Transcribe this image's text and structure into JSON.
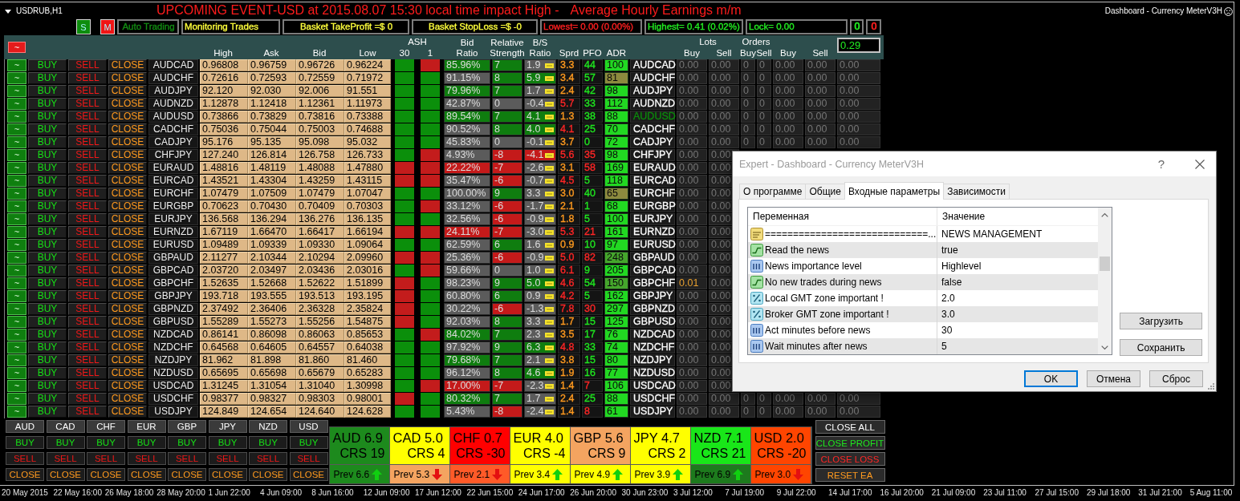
{
  "chart": {
    "symbol": "USDRUB,H1",
    "headline": [
      "UPCOMING EVENT-USD at 2015.08.07 15:30 local time impact High -",
      "Average Hourly Earnings m/m"
    ],
    "indicator": "Dashboard - Currency MeterV3H"
  },
  "controls": {
    "modes": [
      {
        "label": "S",
        "color": "#0d8d0d"
      },
      {
        "label": "M",
        "color": "#f01515"
      }
    ],
    "status": [
      {
        "text": "Auto Trading",
        "color": "#128c12"
      },
      {
        "text": "Monitoring Trades",
        "color": "#ffff3c"
      },
      {
        "text": "Basket TakeProfit =$ 0",
        "color": "#ffff3c"
      },
      {
        "text": "Basket StopLoss =$ -0",
        "color": "#ffff3c"
      },
      {
        "text": "Lowest= 0.00 (0.00%)",
        "color": "#ff2020"
      },
      {
        "text": "Highest= 0.41 (0.02%)",
        "color": "#22ee22"
      },
      {
        "text": "Lock= 0.00",
        "color": "#22ee22"
      }
    ],
    "counters": [
      {
        "text": "0",
        "color": "#22ee22"
      },
      {
        "text": "0",
        "color": "#ff2020"
      }
    ]
  },
  "header": {
    "toggle": "~",
    "high": "High",
    "ask": "Ask",
    "bid": "Bid",
    "low": "Low",
    "ash": {
      "title": "ASH",
      "periods": [
        "30",
        "1"
      ]
    },
    "bid_ratio": "Bid Ratio",
    "strength": "Relative Strength",
    "bs_ratio": "B/S Ratio",
    "spread": "Sprd",
    "pfo": "PFO",
    "adr": "ADR",
    "lots": {
      "title": "Lots",
      "columns": [
        "Buy",
        "Sell"
      ]
    },
    "orders": {
      "title": "Orders",
      "columns": [
        "Buy",
        "Sell"
      ]
    },
    "totals": [
      "Buy",
      "Sell"
    ],
    "field": "0.29"
  },
  "rows": [
    {
      "actions": [
        "~",
        "BUY",
        "SELL",
        "CLOSE"
      ],
      "pair": "AUDCAD",
      "high": "0.96808",
      "ask": "0.96759",
      "bid": "0.96726",
      "low": "0.96224",
      "ash_30": {
        "color": "#0b8f0b"
      },
      "ash_1": {
        "color": "#c31c1c"
      },
      "bid_ratio": {
        "text": "85.96%",
        "color": "#0f7d0f"
      },
      "strength": {
        "text": "7",
        "color": "#0f7d0f"
      },
      "bs_ratio": {
        "text": "1.9",
        "color": "#5b5b5b"
      },
      "spread": {
        "text": "3.3",
        "color": "#ff9a1f"
      },
      "pfo": {
        "text": "44",
        "color": "#1fe61f"
      },
      "adr": {
        "text": "100",
        "color": "#22d822"
      },
      "label": {
        "text": "AUDCAD",
        "color": "#ffffff"
      },
      "open_position": false,
      "positions": [
        "0.00",
        "0.00",
        "0",
        "0",
        "0.00",
        "0.00",
        "0.00"
      ]
    },
    {
      "actions": [
        "~",
        "BUY",
        "SELL",
        "CLOSE"
      ],
      "pair": "AUDCHF",
      "high": "0.72616",
      "ask": "0.72593",
      "bid": "0.72559",
      "low": "0.71972",
      "ash_30": {
        "color": "#0b8f0b"
      },
      "ash_1": {
        "color": "#0b8f0b"
      },
      "bid_ratio": {
        "text": "91.15%",
        "color": "#5b5b5b"
      },
      "strength": {
        "text": "8",
        "color": "#0f7d0f"
      },
      "bs_ratio": {
        "text": "5.9",
        "color": "#0f7d0f"
      },
      "spread": {
        "text": "3.4",
        "color": "#ff9a1f"
      },
      "pfo": {
        "text": "57",
        "color": "#1fe61f"
      },
      "adr": {
        "text": "81",
        "color": "#8c8a3e"
      },
      "label": {
        "text": "AUDCHF",
        "color": "#ffffff"
      },
      "open_position": false,
      "positions": [
        "0.00",
        "0.00",
        "0",
        "0",
        "0.00",
        "0.00",
        "0.00"
      ]
    },
    {
      "actions": [
        "~",
        "BUY",
        "SELL",
        "CLOSE"
      ],
      "pair": "AUDJPY",
      "high": "92.120",
      "ask": "92.030",
      "bid": "92.006",
      "low": "91.551",
      "ash_30": {
        "color": "#0b8f0b"
      },
      "ash_1": {
        "color": "#0b8f0b"
      },
      "bid_ratio": {
        "text": "79.96%",
        "color": "#0f7d0f"
      },
      "strength": {
        "text": "7",
        "color": "#0f7d0f"
      },
      "bs_ratio": {
        "text": "1.7",
        "color": "#5b5b5b"
      },
      "spread": {
        "text": "2.4",
        "color": "#ff9a1f"
      },
      "pfo": {
        "text": "42",
        "color": "#1fe61f"
      },
      "adr": {
        "text": "98",
        "color": "#22d822"
      },
      "label": {
        "text": "AUDJPY",
        "color": "#ffffff"
      },
      "open_position": false,
      "positions": [
        "0.00",
        "0.00",
        "0",
        "0",
        "0.00",
        "0.00",
        "0.00"
      ]
    },
    {
      "actions": [
        "~",
        "BUY",
        "SELL",
        "CLOSE"
      ],
      "pair": "AUDNZD",
      "high": "1.12878",
      "ask": "1.12418",
      "bid": "1.12361",
      "low": "1.11973",
      "ash_30": {
        "color": "#0b8f0b"
      },
      "ash_1": {
        "color": "#0b8f0b"
      },
      "bid_ratio": {
        "text": "42.87%",
        "color": "#5b5b5b"
      },
      "strength": {
        "text": "0",
        "color": "#5b5b5b"
      },
      "bs_ratio": {
        "text": "-0.4",
        "color": "#5b5b5b"
      },
      "spread": {
        "text": "5.7",
        "color": "#ff2626"
      },
      "pfo": {
        "text": "33",
        "color": "#1fe61f"
      },
      "adr": {
        "text": "112",
        "color": "#22d822"
      },
      "label": {
        "text": "AUDNZD",
        "color": "#ffffff"
      },
      "open_position": false,
      "positions": [
        "0.00",
        "0.00",
        "0",
        "0",
        "0.00",
        "0.00",
        "0.00"
      ]
    },
    {
      "actions": [
        "~",
        "BUY",
        "SELL",
        "CLOSE"
      ],
      "pair": "AUDUSD",
      "high": "0.73866",
      "ask": "0.73829",
      "bid": "0.73816",
      "low": "0.73388",
      "ash_30": {
        "color": "#0b8f0b"
      },
      "ash_1": {
        "color": "#0b8f0b"
      },
      "bid_ratio": {
        "text": "89.54%",
        "color": "#0f7d0f"
      },
      "strength": {
        "text": "7",
        "color": "#0f7d0f"
      },
      "bs_ratio": {
        "text": "4.1",
        "color": "#0f7d0f"
      },
      "spread": {
        "text": "1.3",
        "color": "#ff9a1f"
      },
      "pfo": {
        "text": "38",
        "color": "#1fe61f"
      },
      "adr": {
        "text": "88",
        "color": "#22d822"
      },
      "label": {
        "text": "AUDUSD",
        "color": "#0c8c0c"
      },
      "open_position": false,
      "positions": [
        "0.00",
        "0.00",
        "0",
        "0",
        "0.00",
        "0.00",
        "0.00"
      ]
    },
    {
      "actions": [
        "~",
        "BUY",
        "SELL",
        "CLOSE"
      ],
      "pair": "CADCHF",
      "high": "0.75036",
      "ask": "0.75044",
      "bid": "0.75003",
      "low": "0.74688",
      "ash_30": {
        "color": "#0b8f0b"
      },
      "ash_1": {
        "color": "#0b8f0b"
      },
      "bid_ratio": {
        "text": "90.52%",
        "color": "#5b5b5b"
      },
      "strength": {
        "text": "8",
        "color": "#0f7d0f"
      },
      "bs_ratio": {
        "text": "4.0",
        "color": "#0f7d0f"
      },
      "spread": {
        "text": "4.1",
        "color": "#ff2626"
      },
      "pfo": {
        "text": "25",
        "color": "#1fe61f"
      },
      "adr": {
        "text": "70",
        "color": "#22d822"
      },
      "label": {
        "text": "CADCHF",
        "color": "#ffffff"
      },
      "open_position": false,
      "positions": [
        "0.00",
        "0.00",
        "0",
        "0",
        "0.00",
        "0.00",
        "0.00"
      ]
    },
    {
      "actions": [
        "~",
        "BUY",
        "SELL",
        "CLOSE"
      ],
      "pair": "CADJPY",
      "high": "95.176",
      "ask": "95.135",
      "bid": "95.098",
      "low": "95.032",
      "ash_30": {
        "color": "#0b8f0b"
      },
      "ash_1": {
        "color": "#0b8f0b"
      },
      "bid_ratio": {
        "text": "45.83%",
        "color": "#5b5b5b"
      },
      "strength": {
        "text": "0",
        "color": "#5b5b5b"
      },
      "bs_ratio": {
        "text": "-0.1",
        "color": "#5b5b5b"
      },
      "spread": {
        "text": "3.7",
        "color": "#ff9a1f"
      },
      "pfo": {
        "text": "0",
        "color": "#1fe61f"
      },
      "adr": {
        "text": "72",
        "color": "#22d822"
      },
      "label": {
        "text": "CADJPY",
        "color": "#ffffff"
      },
      "open_position": false,
      "positions": [
        "0.00",
        "0.00",
        "0",
        "0",
        "0.00",
        "0.00",
        "0.00"
      ]
    },
    {
      "actions": [
        "~",
        "BUY",
        "SELL",
        "CLOSE"
      ],
      "pair": "CHFJPY",
      "high": "127.240",
      "ask": "126.814",
      "bid": "126.758",
      "low": "126.733",
      "ash_30": {
        "color": "#0b8f0b"
      },
      "ash_1": {
        "color": "#c31c1c"
      },
      "bid_ratio": {
        "text": "4.93%",
        "color": "#5b5b5b"
      },
      "strength": {
        "text": "-8",
        "color": "#c41a1a"
      },
      "bs_ratio": {
        "text": "-4.1",
        "color": "#c41a1a"
      },
      "spread": {
        "text": "5.6",
        "color": "#ff2626"
      },
      "pfo": {
        "text": "35",
        "color": "#ff2626"
      },
      "adr": {
        "text": "98",
        "color": "#22d822"
      },
      "label": {
        "text": "CHFJPY",
        "color": "#ffffff"
      },
      "open_position": false,
      "positions": [
        "0.00",
        "0.00"
      ]
    },
    {
      "actions": [
        "~",
        "BUY",
        "SELL",
        "CLOSE"
      ],
      "pair": "EURAUD",
      "high": "1.48816",
      "ask": "1.48119",
      "bid": "1.48088",
      "low": "1.47880",
      "ash_30": {
        "color": "#c31c1c"
      },
      "ash_1": {
        "color": "#c31c1c"
      },
      "bid_ratio": {
        "text": "22.22%",
        "color": "#c41a1a"
      },
      "strength": {
        "text": "-7",
        "color": "#c41a1a"
      },
      "bs_ratio": {
        "text": "-2.6",
        "color": "#5b5b5b"
      },
      "spread": {
        "text": "3.1",
        "color": "#ff9a1f"
      },
      "pfo": {
        "text": "58",
        "color": "#ff2626"
      },
      "adr": {
        "text": "169",
        "color": "#22d822"
      },
      "label": {
        "text": "EURAUD",
        "color": "#ffffff"
      },
      "open_position": false,
      "positions": [
        "0.00",
        "0.00"
      ]
    },
    {
      "actions": [
        "~",
        "BUY",
        "SELL",
        "CLOSE"
      ],
      "pair": "EURCAD",
      "high": "1.43521",
      "ask": "1.43304",
      "bid": "1.43259",
      "low": "1.43115",
      "ash_30": {
        "color": "#c31c1c"
      },
      "ash_1": {
        "color": "#c31c1c"
      },
      "bid_ratio": {
        "text": "35.47%",
        "color": "#5b5b5b"
      },
      "strength": {
        "text": "-6",
        "color": "#c41a1a"
      },
      "bs_ratio": {
        "text": "-0.7",
        "color": "#5b5b5b"
      },
      "spread": {
        "text": "4.5",
        "color": "#ff2626"
      },
      "pfo": {
        "text": "5",
        "color": "#1fe61f"
      },
      "adr": {
        "text": "118",
        "color": "#22d822"
      },
      "label": {
        "text": "EURCAD",
        "color": "#ffffff"
      },
      "open_position": false,
      "positions": [
        "0.00",
        "0.00"
      ]
    },
    {
      "actions": [
        "~",
        "BUY",
        "SELL",
        "CLOSE"
      ],
      "pair": "EURCHF",
      "high": "1.07479",
      "ask": "1.07509",
      "bid": "1.07479",
      "low": "1.07047",
      "ash_30": {
        "color": "#0b8f0b"
      },
      "ash_1": {
        "color": "#0b8f0b"
      },
      "bid_ratio": {
        "text": "100.00%",
        "color": "#5b5b5b"
      },
      "strength": {
        "text": "9",
        "color": "#0f7d0f"
      },
      "bs_ratio": {
        "text": "3.3",
        "color": "#5b5b5b"
      },
      "spread": {
        "text": "3.0",
        "color": "#ff9a1f"
      },
      "pfo": {
        "text": "40",
        "color": "#1fe61f"
      },
      "adr": {
        "text": "65",
        "color": "#8c8a3e"
      },
      "label": {
        "text": "EURCHF",
        "color": "#ffffff"
      },
      "open_position": false,
      "positions": [
        "0.00",
        "0.00"
      ]
    },
    {
      "actions": [
        "~",
        "BUY",
        "SELL",
        "CLOSE"
      ],
      "pair": "EURGBP",
      "high": "0.70623",
      "ask": "0.70430",
      "bid": "0.70409",
      "low": "0.70303",
      "ash_30": {
        "color": "#0b8f0b"
      },
      "ash_1": {
        "color": "#c31c1c"
      },
      "bid_ratio": {
        "text": "33.12%",
        "color": "#5b5b5b"
      },
      "strength": {
        "text": "-6",
        "color": "#c41a1a"
      },
      "bs_ratio": {
        "text": "-1.7",
        "color": "#5b5b5b"
      },
      "spread": {
        "text": "2.1",
        "color": "#ff9a1f"
      },
      "pfo": {
        "text": "1",
        "color": "#1fe61f"
      },
      "adr": {
        "text": "68",
        "color": "#22d822"
      },
      "label": {
        "text": "EURGBP",
        "color": "#ffffff"
      },
      "open_position": false,
      "positions": [
        "0.00",
        "0.00"
      ]
    },
    {
      "actions": [
        "~",
        "BUY",
        "SELL",
        "CLOSE"
      ],
      "pair": "EURJPY",
      "high": "136.568",
      "ask": "136.294",
      "bid": "136.276",
      "low": "136.135",
      "ash_30": {
        "color": "#0b8f0b"
      },
      "ash_1": {
        "color": "#0b8f0b"
      },
      "bid_ratio": {
        "text": "32.56%",
        "color": "#5b5b5b"
      },
      "strength": {
        "text": "-6",
        "color": "#c41a1a"
      },
      "bs_ratio": {
        "text": "-0.9",
        "color": "#5b5b5b"
      },
      "spread": {
        "text": "1.8",
        "color": "#ff9a1f"
      },
      "pfo": {
        "text": "5",
        "color": "#1fe61f"
      },
      "adr": {
        "text": "100",
        "color": "#22d822"
      },
      "label": {
        "text": "EURJPY",
        "color": "#ffffff"
      },
      "open_position": false,
      "positions": [
        "0.00",
        "0.00"
      ]
    },
    {
      "actions": [
        "~",
        "BUY",
        "SELL",
        "CLOSE"
      ],
      "pair": "EURNZD",
      "high": "1.67119",
      "ask": "1.66470",
      "bid": "1.66417",
      "low": "1.66194",
      "ash_30": {
        "color": "#c31c1c"
      },
      "ash_1": {
        "color": "#c31c1c"
      },
      "bid_ratio": {
        "text": "24.11%",
        "color": "#c41a1a"
      },
      "strength": {
        "text": "-7",
        "color": "#c41a1a"
      },
      "bs_ratio": {
        "text": "-3.0",
        "color": "#5b5b5b"
      },
      "spread": {
        "text": "5.3",
        "color": "#ff2626"
      },
      "pfo": {
        "text": "21",
        "color": "#ff2626"
      },
      "adr": {
        "text": "161",
        "color": "#22d822"
      },
      "label": {
        "text": "EURNZD",
        "color": "#ffffff"
      },
      "open_position": false,
      "positions": [
        "0.00",
        "0.00"
      ]
    },
    {
      "actions": [
        "~",
        "BUY",
        "SELL",
        "CLOSE"
      ],
      "pair": "EURUSD",
      "high": "1.09489",
      "ask": "1.09339",
      "bid": "1.09330",
      "low": "1.09064",
      "ash_30": {
        "color": "#0b8f0b"
      },
      "ash_1": {
        "color": "#0b8f0b"
      },
      "bid_ratio": {
        "text": "62.59%",
        "color": "#5b5b5b"
      },
      "strength": {
        "text": "6",
        "color": "#0f7d0f"
      },
      "bs_ratio": {
        "text": "1.6",
        "color": "#5b5b5b"
      },
      "spread": {
        "text": "0.9",
        "color": "#ff9a1f"
      },
      "pfo": {
        "text": "10",
        "color": "#1fe61f"
      },
      "adr": {
        "text": "97",
        "color": "#22d822"
      },
      "label": {
        "text": "EURUSD",
        "color": "#ffffff"
      },
      "open_position": false,
      "positions": [
        "0.00",
        "0.00"
      ]
    },
    {
      "actions": [
        "~",
        "BUY",
        "SELL",
        "CLOSE"
      ],
      "pair": "GBPAUD",
      "high": "2.11277",
      "ask": "2.10344",
      "bid": "2.10294",
      "low": "2.09960",
      "ash_30": {
        "color": "#c31c1c"
      },
      "ash_1": {
        "color": "#c31c1c"
      },
      "bid_ratio": {
        "text": "25.36%",
        "color": "#5b5b5b"
      },
      "strength": {
        "text": "-6",
        "color": "#c41a1a"
      },
      "bs_ratio": {
        "text": "-0.9",
        "color": "#5b5b5b"
      },
      "spread": {
        "text": "5.0",
        "color": "#ff2626"
      },
      "pfo": {
        "text": "82",
        "color": "#ff2626"
      },
      "adr": {
        "text": "248",
        "color": "#45a62c"
      },
      "label": {
        "text": "GBPAUD",
        "color": "#ffffff"
      },
      "open_position": false,
      "positions": [
        "0.00",
        "0.00"
      ]
    },
    {
      "actions": [
        "~",
        "BUY",
        "SELL",
        "CLOSE"
      ],
      "pair": "GBPCAD",
      "high": "2.03720",
      "ask": "2.03497",
      "bid": "2.03436",
      "low": "2.03016",
      "ash_30": {
        "color": "#0b8f0b"
      },
      "ash_1": {
        "color": "#c31c1c"
      },
      "bid_ratio": {
        "text": "59.66%",
        "color": "#5b5b5b"
      },
      "strength": {
        "text": "0",
        "color": "#5b5b5b"
      },
      "bs_ratio": {
        "text": "1.0",
        "color": "#5b5b5b"
      },
      "spread": {
        "text": "6.1",
        "color": "#ff2626"
      },
      "pfo": {
        "text": "9",
        "color": "#1fe61f"
      },
      "adr": {
        "text": "205",
        "color": "#22d822"
      },
      "label": {
        "text": "GBPCAD",
        "color": "#ffffff"
      },
      "open_position": false,
      "positions": [
        "0.00",
        "0.00"
      ]
    },
    {
      "actions": [
        "~",
        "BUY",
        "SELL",
        "CLOSE"
      ],
      "pair": "GBPCHF",
      "high": "1.52635",
      "ask": "1.52668",
      "bid": "1.52622",
      "low": "1.51899",
      "ash_30": {
        "color": "#c31c1c"
      },
      "ash_1": {
        "color": "#0b8f0b"
      },
      "bid_ratio": {
        "text": "98.23%",
        "color": "#5b5b5b"
      },
      "strength": {
        "text": "9",
        "color": "#0f7d0f"
      },
      "bs_ratio": {
        "text": "5.0",
        "color": "#0f7d0f"
      },
      "spread": {
        "text": "4.6",
        "color": "#ff2626"
      },
      "pfo": {
        "text": "54",
        "color": "#1fe61f"
      },
      "adr": {
        "text": "150",
        "color": "#45a62c"
      },
      "label": {
        "text": "GBPCHF",
        "color": "#ffffff"
      },
      "open_position": true,
      "positions": [
        "0.01",
        "0.00"
      ]
    },
    {
      "actions": [
        "~",
        "BUY",
        "SELL",
        "CLOSE"
      ],
      "pair": "GBPJPY",
      "high": "193.718",
      "ask": "193.555",
      "bid": "193.513",
      "low": "193.195",
      "ash_30": {
        "color": "#c31c1c"
      },
      "ash_1": {
        "color": "#0b8f0b"
      },
      "bid_ratio": {
        "text": "60.80%",
        "color": "#5b5b5b"
      },
      "strength": {
        "text": "6",
        "color": "#0f7d0f"
      },
      "bs_ratio": {
        "text": "0.9",
        "color": "#5b5b5b"
      },
      "spread": {
        "text": "4.2",
        "color": "#ff2626"
      },
      "pfo": {
        "text": "5",
        "color": "#1fe61f"
      },
      "adr": {
        "text": "162",
        "color": "#22d822"
      },
      "label": {
        "text": "GBPJPY",
        "color": "#ffffff"
      },
      "open_position": false,
      "positions": [
        "0.00",
        "0.00"
      ]
    },
    {
      "actions": [
        "~",
        "BUY",
        "SELL",
        "CLOSE"
      ],
      "pair": "GBPNZD",
      "high": "2.37492",
      "ask": "2.36406",
      "bid": "2.36328",
      "low": "2.35824",
      "ash_30": {
        "color": "#c31c1c"
      },
      "ash_1": {
        "color": "#0b8f0b"
      },
      "bid_ratio": {
        "text": "30.22%",
        "color": "#5b5b5b"
      },
      "strength": {
        "text": "-6",
        "color": "#c41a1a"
      },
      "bs_ratio": {
        "text": "-1.3",
        "color": "#5b5b5b"
      },
      "spread": {
        "text": "7.8",
        "color": "#ff2626"
      },
      "pfo": {
        "text": "30",
        "color": "#ff2626"
      },
      "adr": {
        "text": "297",
        "color": "#22d822"
      },
      "label": {
        "text": "GBPNZD",
        "color": "#ffffff"
      },
      "open_position": false,
      "positions": [
        "0.00",
        "0.00"
      ]
    },
    {
      "actions": [
        "~",
        "BUY",
        "SELL",
        "CLOSE"
      ],
      "pair": "GBPUSD",
      "high": "1.55289",
      "ask": "1.55273",
      "bid": "1.55256",
      "low": "1.54875",
      "ash_30": {
        "color": "#c31c1c"
      },
      "ash_1": {
        "color": "#0b8f0b"
      },
      "bid_ratio": {
        "text": "92.03%",
        "color": "#5b5b5b"
      },
      "strength": {
        "text": "8",
        "color": "#0f7d0f"
      },
      "bs_ratio": {
        "text": "3.3",
        "color": "#5b5b5b"
      },
      "spread": {
        "text": "1.7",
        "color": "#ff9a1f"
      },
      "pfo": {
        "text": "15",
        "color": "#1fe61f"
      },
      "adr": {
        "text": "125",
        "color": "#22d822"
      },
      "label": {
        "text": "GBPUSD",
        "color": "#ffffff"
      },
      "open_position": false,
      "positions": [
        "0.00",
        "0.00"
      ]
    },
    {
      "actions": [
        "~",
        "BUY",
        "SELL",
        "CLOSE"
      ],
      "pair": "NZDCAD",
      "high": "0.86141",
      "ask": "0.86098",
      "bid": "0.86063",
      "low": "0.85653",
      "ash_30": {
        "color": "#0b8f0b"
      },
      "ash_1": {
        "color": "#c31c1c"
      },
      "bid_ratio": {
        "text": "84.02%",
        "color": "#0f7d0f"
      },
      "strength": {
        "text": "7",
        "color": "#0f7d0f"
      },
      "bs_ratio": {
        "text": "2.3",
        "color": "#5b5b5b"
      },
      "spread": {
        "text": "3.5",
        "color": "#ff9a1f"
      },
      "pfo": {
        "text": "17",
        "color": "#1fe61f"
      },
      "adr": {
        "text": "76",
        "color": "#22d822"
      },
      "label": {
        "text": "NZDCAD",
        "color": "#ffffff"
      },
      "open_position": false,
      "positions": [
        "0.00",
        "0.00"
      ]
    },
    {
      "actions": [
        "~",
        "BUY",
        "SELL",
        "CLOSE"
      ],
      "pair": "NZDCHF",
      "high": "0.64568",
      "ask": "0.64605",
      "bid": "0.64557",
      "low": "0.64038",
      "ash_30": {
        "color": "#0b8f0b"
      },
      "ash_1": {
        "color": "#0b8f0b"
      },
      "bid_ratio": {
        "text": "97.92%",
        "color": "#5b5b5b"
      },
      "strength": {
        "text": "9",
        "color": "#0f7d0f"
      },
      "bs_ratio": {
        "text": "6.3",
        "color": "#0f7d0f"
      },
      "spread": {
        "text": "4.8",
        "color": "#ff2626"
      },
      "pfo": {
        "text": "33",
        "color": "#1fe61f"
      },
      "adr": {
        "text": "74",
        "color": "#22d822"
      },
      "label": {
        "text": "NZDCHF",
        "color": "#ffffff"
      },
      "open_position": false,
      "positions": [
        "0.00",
        "0.00"
      ]
    },
    {
      "actions": [
        "~",
        "BUY",
        "SELL",
        "CLOSE"
      ],
      "pair": "NZDJPY",
      "high": "81.962",
      "ask": "81.898",
      "bid": "81.860",
      "low": "81.460",
      "ash_30": {
        "color": "#0b8f0b"
      },
      "ash_1": {
        "color": "#0b8f0b"
      },
      "bid_ratio": {
        "text": "79.68%",
        "color": "#0f7d0f"
      },
      "strength": {
        "text": "7",
        "color": "#0f7d0f"
      },
      "bs_ratio": {
        "text": "2.1",
        "color": "#5b5b5b"
      },
      "spread": {
        "text": "3.8",
        "color": "#ff9a1f"
      },
      "pfo": {
        "text": "15",
        "color": "#1fe61f"
      },
      "adr": {
        "text": "80",
        "color": "#22d822"
      },
      "label": {
        "text": "NZDJPY",
        "color": "#ffffff"
      },
      "open_position": false,
      "positions": [
        "0.00",
        "0.00"
      ]
    },
    {
      "actions": [
        "~",
        "BUY",
        "SELL",
        "CLOSE"
      ],
      "pair": "NZDUSD",
      "high": "0.65695",
      "ask": "0.65698",
      "bid": "0.65679",
      "low": "0.65283",
      "ash_30": {
        "color": "#0b8f0b"
      },
      "ash_1": {
        "color": "#0b8f0b"
      },
      "bid_ratio": {
        "text": "96.12%",
        "color": "#5b5b5b"
      },
      "strength": {
        "text": "8",
        "color": "#0f7d0f"
      },
      "bs_ratio": {
        "text": "4.6",
        "color": "#0f7d0f"
      },
      "spread": {
        "text": "1.9",
        "color": "#ff9a1f"
      },
      "pfo": {
        "text": "16",
        "color": "#1fe61f"
      },
      "adr": {
        "text": "77",
        "color": "#22d822"
      },
      "label": {
        "text": "NZDUSD",
        "color": "#ffffff"
      },
      "open_position": false,
      "positions": [
        "0.00",
        "0.00"
      ]
    },
    {
      "actions": [
        "~",
        "BUY",
        "SELL",
        "CLOSE"
      ],
      "pair": "USDCAD",
      "high": "1.31245",
      "ask": "1.31054",
      "bid": "1.31040",
      "low": "1.30998",
      "ash_30": {
        "color": "#0b8f0b"
      },
      "ash_1": {
        "color": "#c31c1c"
      },
      "bid_ratio": {
        "text": "17.00%",
        "color": "#c41a1a"
      },
      "strength": {
        "text": "-7",
        "color": "#c41a1a"
      },
      "bs_ratio": {
        "text": "-2.3",
        "color": "#5b5b5b"
      },
      "spread": {
        "text": "1.4",
        "color": "#ff9a1f"
      },
      "pfo": {
        "text": "7",
        "color": "#ff2626"
      },
      "adr": {
        "text": "106",
        "color": "#22d822"
      },
      "label": {
        "text": "USDCAD",
        "color": "#ffffff"
      },
      "open_position": false,
      "positions": [
        "0.00",
        "0.00"
      ]
    },
    {
      "actions": [
        "~",
        "BUY",
        "SELL",
        "CLOSE"
      ],
      "pair": "USDCHF",
      "high": "0.98377",
      "ask": "0.98327",
      "bid": "0.98303",
      "low": "0.98001",
      "ash_30": {
        "color": "#c31c1c"
      },
      "ash_1": {
        "color": "#0b8f0b"
      },
      "bid_ratio": {
        "text": "80.32%",
        "color": "#0f7d0f"
      },
      "strength": {
        "text": "7",
        "color": "#0f7d0f"
      },
      "bs_ratio": {
        "text": "1.7",
        "color": "#5b5b5b"
      },
      "spread": {
        "text": "2.4",
        "color": "#ff9a1f"
      },
      "pfo": {
        "text": "25",
        "color": "#1fe61f"
      },
      "adr": {
        "text": "88",
        "color": "#22d822"
      },
      "label": {
        "text": "USDCHF",
        "color": "#ffffff"
      },
      "open_position": false,
      "positions": [
        "0.00",
        "0.00",
        "0",
        "0",
        "0.00",
        "0.00",
        "0.00"
      ]
    },
    {
      "actions": [
        "~",
        "BUY",
        "SELL",
        "CLOSE"
      ],
      "pair": "USDJPY",
      "high": "124.849",
      "ask": "124.654",
      "bid": "124.640",
      "low": "124.628",
      "ash_30": {
        "color": "#0b8f0b"
      },
      "ash_1": {
        "color": "#0b8f0b"
      },
      "bid_ratio": {
        "text": "5.43%",
        "color": "#5b5b5b"
      },
      "strength": {
        "text": "-8",
        "color": "#c41a1a"
      },
      "bs_ratio": {
        "text": "-2.4",
        "color": "#5b5b5b"
      },
      "spread": {
        "text": "1.4",
        "color": "#ff9a1f"
      },
      "pfo": {
        "text": "8",
        "color": "#ff2626"
      },
      "adr": {
        "text": "61",
        "color": "#22d822"
      },
      "label": {
        "text": "USDJPY",
        "color": "#ffffff"
      },
      "open_position": false,
      "positions": [
        "0.00",
        "0.00",
        "0",
        "0",
        "0.00",
        "0.00",
        "0.00"
      ]
    }
  ],
  "panel": {
    "currencies": [
      {
        "name": "AUD",
        "buy": "BUY",
        "sell": "SELL",
        "close": "CLOSE"
      },
      {
        "name": "CAD",
        "buy": "BUY",
        "sell": "SELL",
        "close": "CLOSE"
      },
      {
        "name": "CHF",
        "buy": "BUY",
        "sell": "SELL",
        "close": "CLOSE"
      },
      {
        "name": "EUR",
        "buy": "BUY",
        "sell": "SELL",
        "close": "CLOSE"
      },
      {
        "name": "GBP",
        "buy": "BUY",
        "sell": "SELL",
        "close": "CLOSE"
      },
      {
        "name": "JPY",
        "buy": "BUY",
        "sell": "SELL",
        "close": "CLOSE"
      },
      {
        "name": "NZD",
        "buy": "BUY",
        "sell": "SELL",
        "close": "CLOSE"
      },
      {
        "name": "USD",
        "buy": "BUY",
        "sell": "SELL",
        "close": "CLOSE"
      }
    ],
    "tiles": [
      {
        "title": "AUD 6.9",
        "crs": "CRS 19",
        "rising": true,
        "color": "#1d8a1d",
        "previous": {
          "text": "Prev 6.6",
          "color": "#1d8a1d"
        }
      },
      {
        "title": "CAD 5.0",
        "crs": "CRS 4",
        "rising": false,
        "color": "#ffff00",
        "previous": {
          "text": "Prev 5.3",
          "color": "#f4a460"
        }
      },
      {
        "title": "CHF 0.7",
        "crs": "CRS -30",
        "rising": false,
        "color": "#ff0000",
        "previous": {
          "text": "Prev 2.1",
          "color": "#ff5a28"
        }
      },
      {
        "title": "EUR 4.0",
        "crs": "CRS -4",
        "rising": true,
        "color": "#ffff00",
        "previous": {
          "text": "Prev 3.4",
          "color": "#ffff00"
        }
      },
      {
        "title": "GBP 5.6",
        "crs": "CRS 9",
        "rising": true,
        "color": "#f4a460",
        "previous": {
          "text": "Prev 4.9",
          "color": "#ffff00"
        }
      },
      {
        "title": "JPY 4.7",
        "crs": "CRS 2",
        "rising": true,
        "color": "#ffff00",
        "previous": {
          "text": "Prev 3.9",
          "color": "#ffff00"
        }
      },
      {
        "title": "NZD 7.1",
        "crs": "CRS 21",
        "rising": true,
        "color": "#19e619",
        "previous": {
          "text": "Prev 6.9",
          "color": "#1d7a1d"
        }
      },
      {
        "title": "USD 2.0",
        "crs": "CRS -20",
        "rising": false,
        "color": "#ff4500",
        "previous": {
          "text": "Prev 3.0",
          "color": "#ff4500"
        }
      }
    ],
    "actions": [
      {
        "label": "CLOSE ALL",
        "kind": "all"
      },
      {
        "label": "CLOSE PROFIT",
        "kind": "profit"
      },
      {
        "label": "CLOSE LOSS",
        "kind": "loss"
      },
      {
        "label": "RESET EA",
        "kind": "reset"
      }
    ]
  },
  "time_axis": [
    "20 May 2015",
    "22 May 16:00",
    "26 May 18:00",
    "28 May 20:00",
    "1 Jun 22:00",
    "4 Jun 09:00",
    "8 Jun 16:00",
    "12 Jun 09:00",
    "17 Jun 12:00",
    "22 Jun 15:00",
    "24 Jun 17:00",
    "26 Jun 20:00",
    "30 Jun 23:00",
    "3 Jul 12:00",
    "7 Jul 19:00",
    "9 Jul 22:00",
    "14 Jul 17:00",
    "16 Jul 20:00",
    "21 Jul 09:00",
    "23 Jul 11:00",
    "27 Jul 15:00",
    "29 Jul 18:00",
    "31 Jul 21:00",
    "5 Aug 11:00"
  ],
  "dialog": {
    "title": "Expert - Dashboard - Currency MeterV3H",
    "help": "?",
    "tabs": [
      {
        "label": "О программе",
        "selected": false
      },
      {
        "label": "Общие",
        "selected": false
      },
      {
        "label": "Входные параметры",
        "selected": true
      },
      {
        "label": "Зависимости",
        "selected": false
      }
    ],
    "columns": [
      "Переменная",
      "Значение"
    ],
    "params": [
      {
        "kind": "string",
        "name": "=============================...",
        "value": "NEWS MANAGEMENT"
      },
      {
        "kind": "bool",
        "name": "Read the news",
        "value": "true"
      },
      {
        "kind": "int",
        "name": "News importance level",
        "value": "Highlevel"
      },
      {
        "kind": "bool",
        "name": "No new trades during news",
        "value": "false"
      },
      {
        "kind": "double",
        "name": "Local GMT zone important !",
        "value": "2.0"
      },
      {
        "kind": "double",
        "name": "Broker GMT zone important !",
        "value": "3.0"
      },
      {
        "kind": "int",
        "name": "Act minutes before news",
        "value": "30"
      },
      {
        "kind": "int",
        "name": "Wait minutes after news",
        "value": "5"
      }
    ],
    "side_buttons": [
      "Загрузить",
      "Сохранить"
    ],
    "buttons": [
      {
        "label": "OK",
        "default": true
      },
      {
        "label": "Отмена",
        "default": false
      },
      {
        "label": "Сброс",
        "default": false
      }
    ]
  }
}
